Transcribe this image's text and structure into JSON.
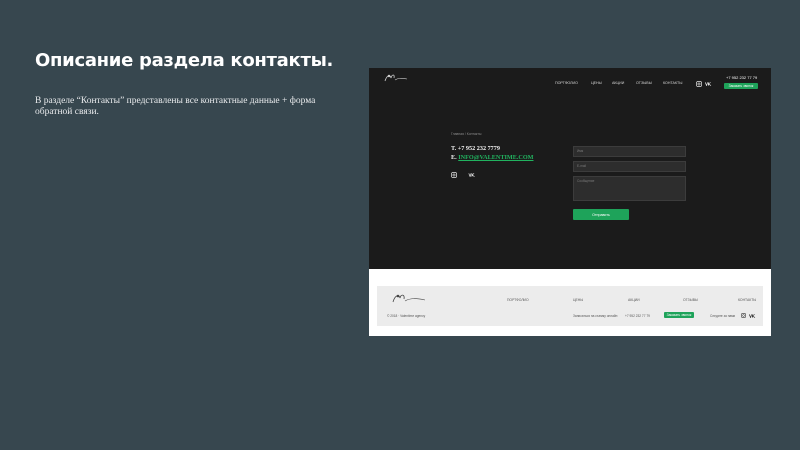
{
  "slide": {
    "title": "Описание раздела контакты.",
    "body": "В разделе “Контакты” представлены все контактные данные + форма обратной связи."
  },
  "site": {
    "nav": [
      "Портфолио",
      "Цены",
      "Акции",
      "Отзывы",
      "Контакты"
    ],
    "header_phone": "+7 952 232 77 79",
    "header_button": "Заказать звонок",
    "breadcrumb": "Главная  /  Контакты",
    "phone_line": "T. +7 952 232 7779",
    "email_prefix": "E.",
    "email": "INFO@VALENTIME.COM",
    "form": {
      "name_placeholder": "Имя",
      "email_placeholder": "E-mail",
      "comment_placeholder": "Сообщение",
      "submit_label": "Отправить"
    },
    "footer": {
      "nav": [
        "Портфолио",
        "Цены",
        "Акции",
        "Отзывы",
        "Контакты"
      ],
      "copyright": "© 2018 · Valentime agency",
      "callback_text": "Записаться на съемку онлайн",
      "phone": "+7 952 232 77 79",
      "button": "Заказать звонок",
      "social_text": "Следите за нами"
    }
  },
  "colors": {
    "slide_bg": "#37474f",
    "site_bg": "#1b1b1b",
    "accent_green": "#1ea35a",
    "footer_bg": "#ececec"
  },
  "icons": [
    "logo-icon",
    "instagram-icon",
    "vk-icon"
  ]
}
